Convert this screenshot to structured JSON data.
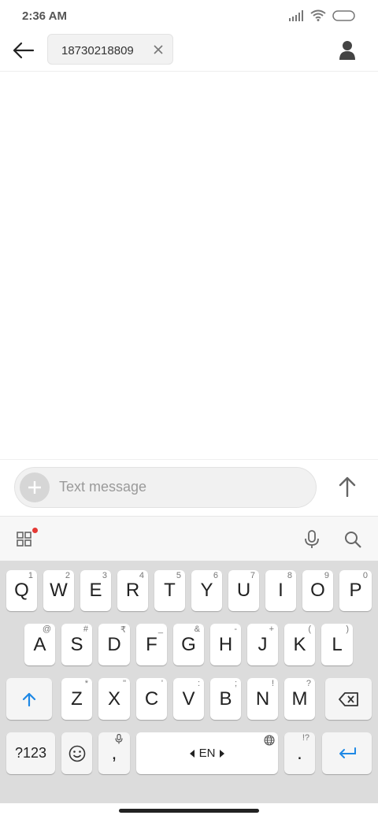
{
  "status_bar": {
    "time": "2:36 AM"
  },
  "header": {
    "recipient": "18730218809"
  },
  "composer": {
    "placeholder": "Text message"
  },
  "keyboard": {
    "row1": [
      {
        "key": "Q",
        "hint": "1"
      },
      {
        "key": "W",
        "hint": "2"
      },
      {
        "key": "E",
        "hint": "3"
      },
      {
        "key": "R",
        "hint": "4"
      },
      {
        "key": "T",
        "hint": "5"
      },
      {
        "key": "Y",
        "hint": "6"
      },
      {
        "key": "U",
        "hint": "7"
      },
      {
        "key": "I",
        "hint": "8"
      },
      {
        "key": "O",
        "hint": "9"
      },
      {
        "key": "P",
        "hint": "0"
      }
    ],
    "row2": [
      {
        "key": "A",
        "hint": "@"
      },
      {
        "key": "S",
        "hint": "#"
      },
      {
        "key": "D",
        "hint": "₹"
      },
      {
        "key": "F",
        "hint": "_"
      },
      {
        "key": "G",
        "hint": "&"
      },
      {
        "key": "H",
        "hint": "-"
      },
      {
        "key": "J",
        "hint": "+"
      },
      {
        "key": "K",
        "hint": "("
      },
      {
        "key": "L",
        "hint": ")"
      }
    ],
    "row3": [
      {
        "key": "Z",
        "hint": "*"
      },
      {
        "key": "X",
        "hint": "\""
      },
      {
        "key": "C",
        "hint": "'"
      },
      {
        "key": "V",
        "hint": ":"
      },
      {
        "key": "B",
        "hint": ";"
      },
      {
        "key": "N",
        "hint": "!"
      },
      {
        "key": "M",
        "hint": "?"
      }
    ],
    "symbols_label": "?123",
    "comma": ",",
    "space_label": "EN",
    "period": ".",
    "period_hint": "!?"
  }
}
